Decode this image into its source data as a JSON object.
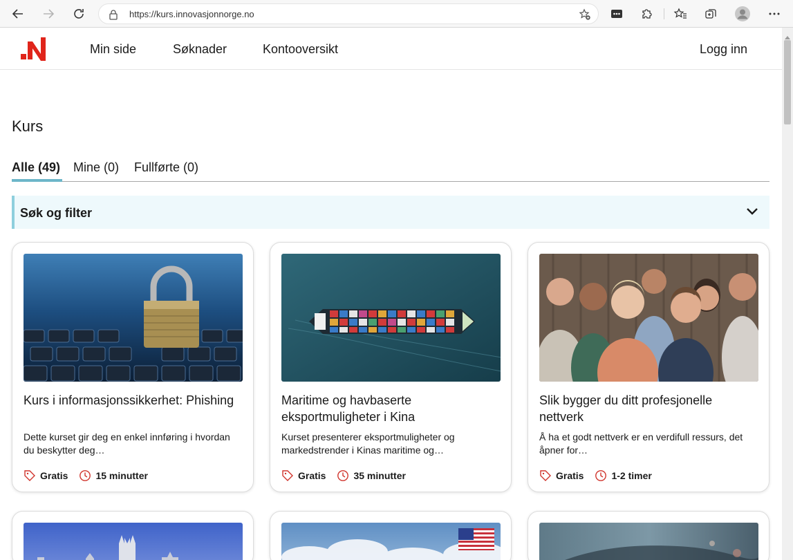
{
  "browser": {
    "url": "https://kurs.innovasjonnorge.no",
    "icons": [
      "back-arrow-icon",
      "forward-arrow-icon",
      "refresh-icon",
      "lock-icon",
      "add-favorite-icon",
      "extension-icon",
      "puzzle-icon",
      "favorites-icon",
      "collections-icon",
      "profile-icon",
      "more-icon"
    ]
  },
  "header": {
    "nav": [
      "Min side",
      "Søknader",
      "Kontooversikt"
    ],
    "login": "Logg inn",
    "brand_color": "#e0251b"
  },
  "page": {
    "title": "Kurs",
    "tabs": [
      "Alle (49)",
      "Mine (0)",
      "Fullførte (0)"
    ],
    "filter_label": "Søk og filter",
    "accent": "#6db6c9"
  },
  "cards": [
    {
      "title": "Kurs i informasjonssikkerhet: Phishing",
      "description": "Dette kurset gir deg en enkel innføring i hvordan du beskytter deg…",
      "price": "Gratis",
      "duration": "15 minutter"
    },
    {
      "title": "Maritime og havbaserte eksportmuligheter i Kina",
      "description": "Kurset presenterer eksportmuligheter og markedstrender i Kinas maritime og…",
      "price": "Gratis",
      "duration": "35 minutter"
    },
    {
      "title": "Slik bygger du ditt profesjonelle nettverk",
      "description": "Å ha et godt nettverk er en verdifull ressurs, det åpner for…",
      "price": "Gratis",
      "duration": "1-2 timer"
    }
  ],
  "icon_color": "#d0342c"
}
